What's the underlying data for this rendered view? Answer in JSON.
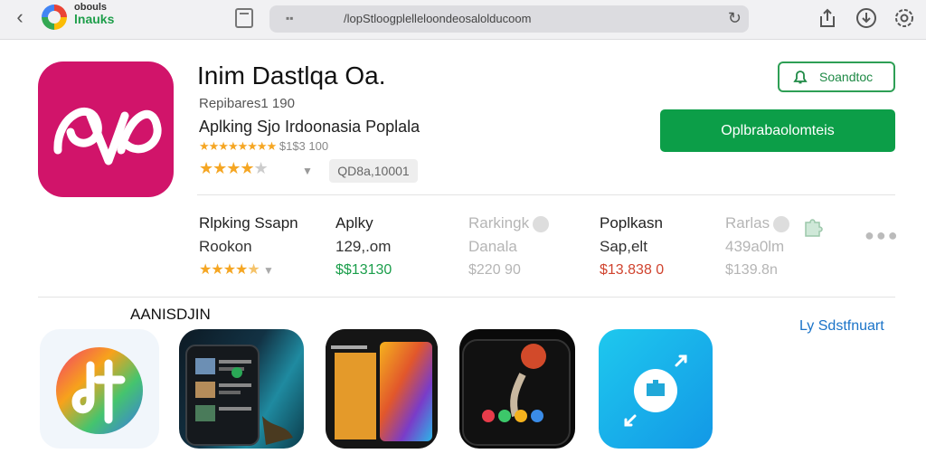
{
  "browser": {
    "brand_line1": "obouls",
    "brand_line2": "lnauks",
    "address": "/lopStloogplelleloondeosalolducoom"
  },
  "app": {
    "title": "Inim Dastlqa Oa.",
    "developer": "Repibares1 190",
    "category": "Aplking Sjo Irdoonasia Poplala",
    "rating_text": "$1$3 100",
    "downloads": "QD8a,10001",
    "wishlist_label": "Soandtoc",
    "install_label": "Oplbrabaolomteis"
  },
  "stats": [
    {
      "line1": "Rlpking Ssapn",
      "line2": "Rookon",
      "line3_type": "stars",
      "rating": 4.5
    },
    {
      "line1": "Aplky",
      "line2": "129,.om",
      "line3": "$$13130"
    },
    {
      "line1": "Rarkingk",
      "line2": "Danala",
      "line3": "$220 90"
    },
    {
      "line1": "Poplkasn",
      "line2": "Sap,elt",
      "line3": "$13.838 0"
    },
    {
      "line1": "Rarlas",
      "line2": "439a0lm",
      "line3": "$139.8n"
    }
  ],
  "section": {
    "title": "AANISDJIN",
    "see_all": "Ly Sdstfnuart"
  },
  "colors": {
    "install_green": "#0c9e48",
    "app_icon_magenta": "#d1146a",
    "link_blue": "#1a73c8",
    "star": "#f5a623"
  }
}
